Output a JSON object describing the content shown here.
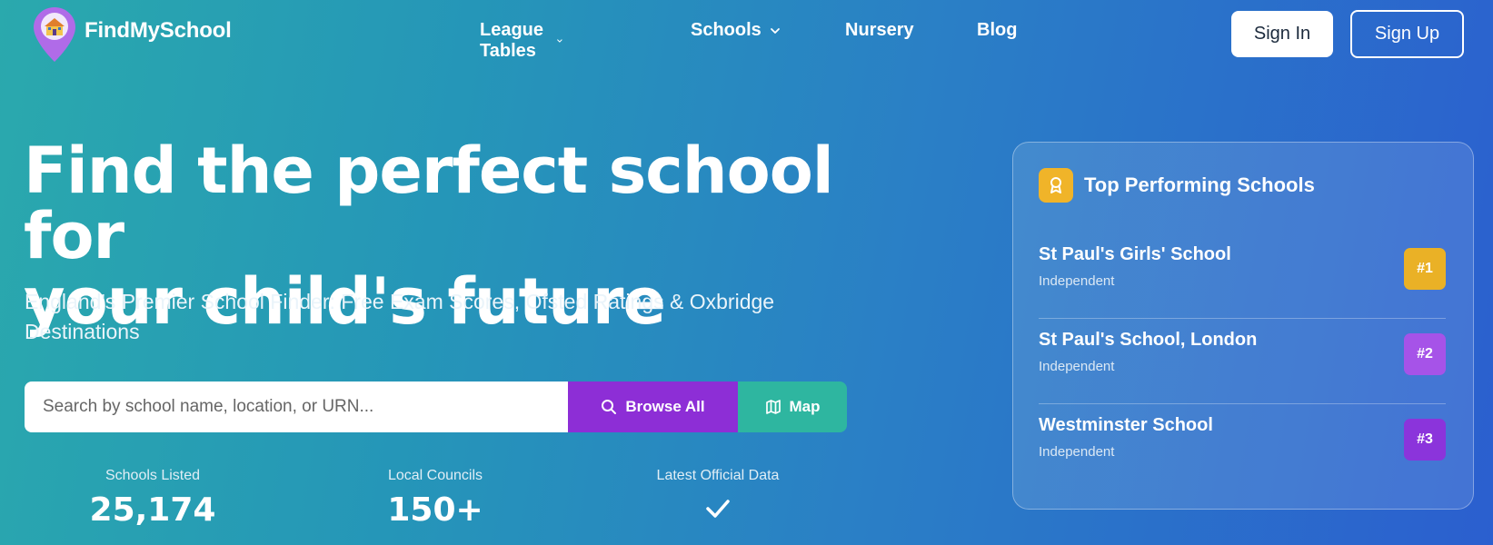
{
  "brand": {
    "name": "FindMySchool"
  },
  "nav": {
    "league_tables": "League Tables",
    "schools": "Schools",
    "nursery": "Nursery",
    "blog": "Blog"
  },
  "auth": {
    "sign_in": "Sign In",
    "sign_up": "Sign Up"
  },
  "hero": {
    "title_line1": "Find the perfect school for",
    "title_line2": "your child's future",
    "subtitle_line1": "England's Premier School Finder: Free Exam Scores, Ofsted Ratings & Oxbridge",
    "subtitle_line2": "Destinations"
  },
  "search": {
    "placeholder": "Search by school name, location, or URN...",
    "value": "",
    "browse_label": "Browse All",
    "map_label": "Map"
  },
  "stats": [
    {
      "label": "Schools Listed",
      "value": "25,174"
    },
    {
      "label": "Local Councils",
      "value": "150+"
    },
    {
      "label": "Latest Official Data",
      "value": "",
      "icon": "check-icon"
    }
  ],
  "top_schools": {
    "title": "Top Performing Schools",
    "items": [
      {
        "name": "St Paul's Girls' School",
        "type": "Independent",
        "rank": "#1",
        "color": "#eab126"
      },
      {
        "name": "St Paul's School, London",
        "type": "Independent",
        "rank": "#2",
        "color": "#a653e8"
      },
      {
        "name": "Westminster School",
        "type": "Independent",
        "rank": "#3",
        "color": "#8b34db"
      }
    ]
  },
  "colors": {
    "browse": "#8d2ed6",
    "map": "#2eb6a0",
    "award": "#f0b429"
  }
}
